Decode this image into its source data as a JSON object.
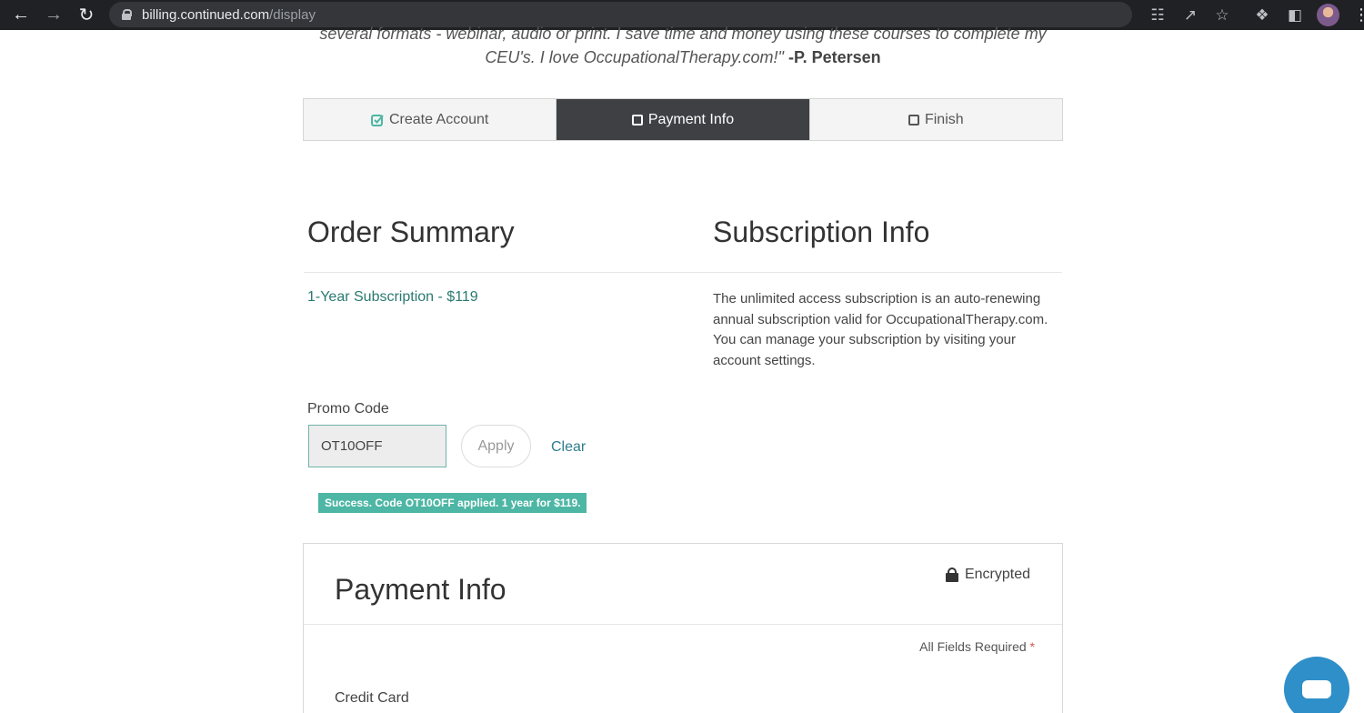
{
  "browser": {
    "url_host": "billing.continued.com",
    "url_path": "/display"
  },
  "testimonial": {
    "line1": "several formats - webinar, audio or print. I save time and money using these courses to complete my",
    "line2": "CEU's. I love OccupationalTherapy.com!\"",
    "author": "-P. Petersen"
  },
  "steps": [
    {
      "label": "Create Account",
      "state": "done"
    },
    {
      "label": "Payment Info",
      "state": "active"
    },
    {
      "label": "Finish",
      "state": "pending"
    }
  ],
  "order_summary": {
    "title": "Order Summary",
    "item": "1-Year Subscription - $119"
  },
  "subscription_info": {
    "title": "Subscription Info",
    "text": "The unlimited access subscription is an auto-renewing annual subscription valid for OccupationalTherapy.com. You can manage your subscription by visiting your account settings."
  },
  "promo": {
    "label": "Promo Code",
    "value": "OT10OFF",
    "apply_label": "Apply",
    "clear_label": "Clear",
    "success_message": "Success. Code OT10OFF applied. 1 year for $119."
  },
  "payment": {
    "title": "Payment Info",
    "encrypted_label": "Encrypted",
    "required_note": "All Fields Required",
    "required_star": "*",
    "credit_card_label": "Credit Card"
  },
  "colors": {
    "accent": "#4db6a4",
    "link": "#2a7a70",
    "active_step": "#3e4044",
    "chat": "#2f8fc8"
  }
}
